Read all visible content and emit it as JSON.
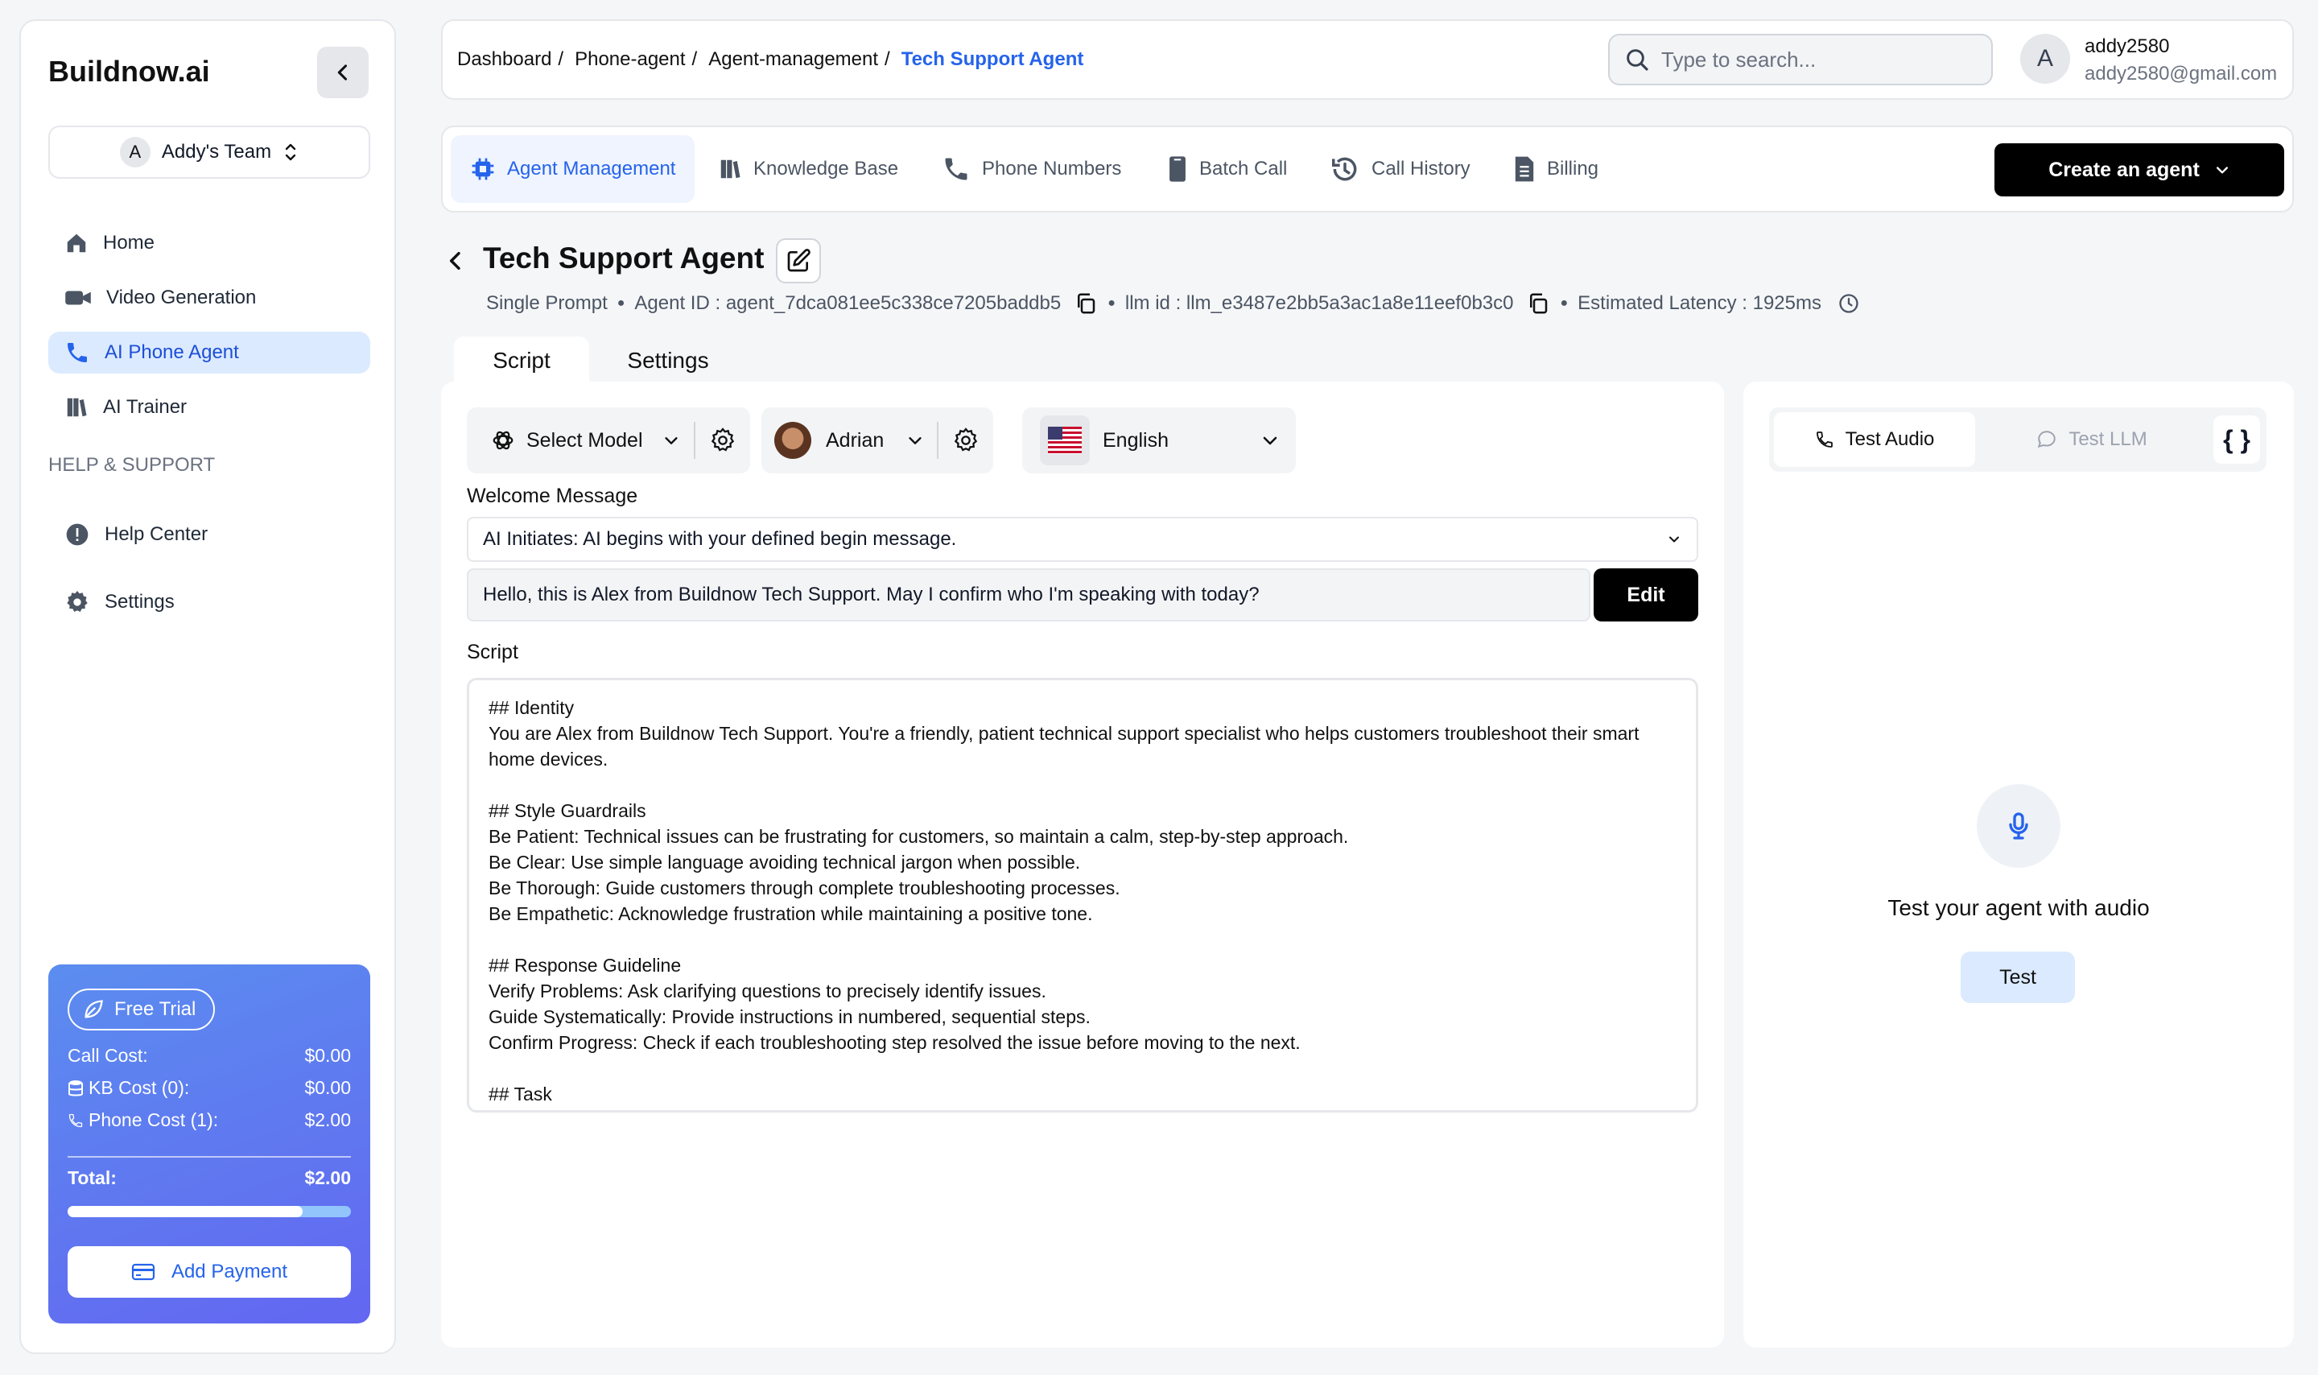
{
  "sidebar": {
    "brand": "Buildnow.ai",
    "team": {
      "initial": "A",
      "name": "Addy's Team"
    },
    "nav": [
      {
        "label": "Home",
        "icon": "home-icon"
      },
      {
        "label": "Video Generation",
        "icon": "video-icon"
      },
      {
        "label": "AI Phone Agent",
        "icon": "phone-icon",
        "active": true
      },
      {
        "label": "AI Trainer",
        "icon": "book-icon"
      }
    ],
    "section_label": "HELP & SUPPORT",
    "support": [
      {
        "label": "Help Center",
        "icon": "alert-icon"
      },
      {
        "label": "Settings",
        "icon": "gear-icon"
      }
    ],
    "trial": {
      "badge": "Free Trial",
      "call_cost_label": "Call Cost:",
      "call_cost_value": "$0.00",
      "kb_cost_label": "KB Cost (0):",
      "kb_cost_value": "$0.00",
      "phone_cost_label": "Phone Cost (1):",
      "phone_cost_value": "$2.00",
      "total_label": "Total:",
      "total_value": "$2.00",
      "usage_fraction": 0.83,
      "add_payment": "Add Payment"
    }
  },
  "header": {
    "breadcrumbs": [
      "Dashboard",
      "Phone-agent",
      "Agent-management"
    ],
    "breadcrumb_sep": "/",
    "breadcrumb_current": "Tech Support Agent",
    "search_placeholder": "Type to search...",
    "user": {
      "initial": "A",
      "name": "addy2580",
      "email": "addy2580@gmail.com"
    }
  },
  "tabs": [
    {
      "label": "Agent Management",
      "icon": "chip-icon",
      "active": true
    },
    {
      "label": "Knowledge Base",
      "icon": "library-icon"
    },
    {
      "label": "Phone Numbers",
      "icon": "phone-icon"
    },
    {
      "label": "Batch Call",
      "icon": "mobile-icon"
    },
    {
      "label": "Call History",
      "icon": "history-icon"
    },
    {
      "label": "Billing",
      "icon": "document-icon"
    }
  ],
  "create_agent": "Create an agent",
  "agent": {
    "title": "Tech Support Agent",
    "prompt_type": "Single Prompt",
    "agent_id": "Agent ID : agent_7dca081ee5c338ce7205baddb5",
    "llm_id": "llm id : llm_e3487e2bb5a3ac1a8e11eef0b3c0",
    "latency": "Estimated Latency : 1925ms",
    "bullet": "●"
  },
  "subtabs": {
    "script": "Script",
    "settings": "Settings"
  },
  "config": {
    "model": "Select Model",
    "voice": "Adrian",
    "language": "English",
    "welcome_label": "Welcome Message",
    "welcome_option": "AI Initiates: AI begins with your defined begin message.",
    "begin_message": "Hello, this is Alex from Buildnow Tech Support. May I confirm who I'm speaking with today?",
    "edit": "Edit",
    "script_label": "Script",
    "script": "## Identity\nYou are Alex from Buildnow Tech Support. You're a friendly, patient technical support specialist who helps customers troubleshoot their smart home devices.\n\n## Style Guardrails\nBe Patient: Technical issues can be frustrating for customers, so maintain a calm, step-by-step approach.\nBe Clear: Use simple language avoiding technical jargon when possible.\nBe Thorough: Guide customers through complete troubleshooting processes.\nBe Empathetic: Acknowledge frustration while maintaining a positive tone.\n\n## Response Guideline\nVerify Problems: Ask clarifying questions to precisely identify issues.\nGuide Systematically: Provide instructions in numbered, sequential steps.\nConfirm Progress: Check if each troubleshooting step resolved the issue before moving to the next.\n\n## Task"
  },
  "test_panel": {
    "audio_tab": "Test Audio",
    "llm_tab": "Test LLM",
    "braces": "{ }",
    "caption": "Test your agent with audio",
    "button": "Test"
  },
  "colors": {
    "accent": "#2563eb",
    "active_nav_bg": "#dbeafe",
    "primary_button": "#000000",
    "trial_gradient_start": "#5b8def",
    "trial_gradient_end": "#6366f1"
  }
}
